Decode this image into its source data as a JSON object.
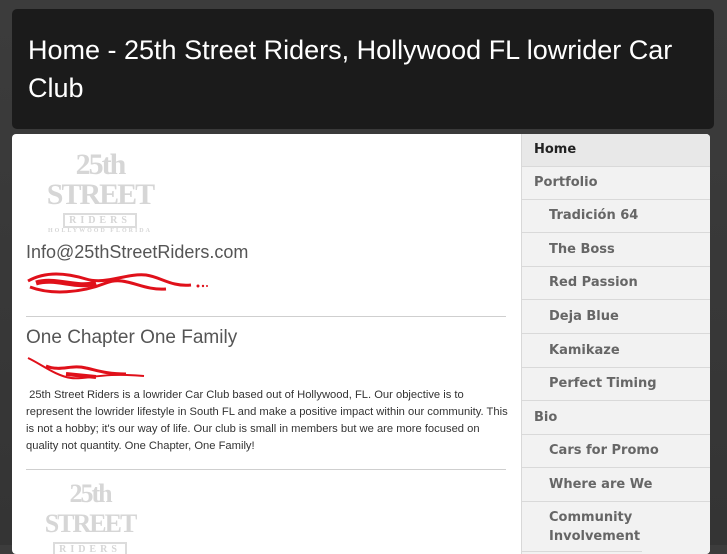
{
  "header": {
    "title": "Home - 25th Street Riders, Hollywood FL lowrider Car Club"
  },
  "logo": {
    "line1": "25th STREET",
    "line2": "RIDERS",
    "line3": "HOLLYWOOD FLORIDA"
  },
  "main": {
    "email": "Info@25thStreetRiders.com",
    "section_title": "One Chapter One Family",
    "body": " 25th Street Riders is a lowrider Car Club based out of Hollywood, FL. Our objective is to represent the lowrider lifestyle in South FL and make a positive impact within our community. This is not a hobby; it's our way of life. Our club is small in members but we are more focused on quality not quantity. One Chapter, One Family!"
  },
  "sidebar": {
    "items": [
      {
        "label": "Home",
        "level": "top",
        "active": true
      },
      {
        "label": "Portfolio",
        "level": "top",
        "active": false
      },
      {
        "label": "Tradición 64",
        "level": "sub",
        "active": false
      },
      {
        "label": "The Boss",
        "level": "sub",
        "active": false
      },
      {
        "label": "Red Passion",
        "level": "sub",
        "active": false
      },
      {
        "label": "Deja Blue",
        "level": "sub",
        "active": false
      },
      {
        "label": "Kamikaze",
        "level": "sub",
        "active": false
      },
      {
        "label": "Perfect Timing",
        "level": "sub",
        "active": false
      },
      {
        "label": "Bio",
        "level": "top",
        "active": false
      },
      {
        "label": "Cars for Promo",
        "level": "sub",
        "active": false
      },
      {
        "label": "Where are We",
        "level": "sub",
        "active": false
      },
      {
        "label": "Community Involvement",
        "level": "sub",
        "active": false
      }
    ]
  },
  "colors": {
    "accent_red": "#e0101a",
    "header_bg": "#1b1b1b"
  }
}
